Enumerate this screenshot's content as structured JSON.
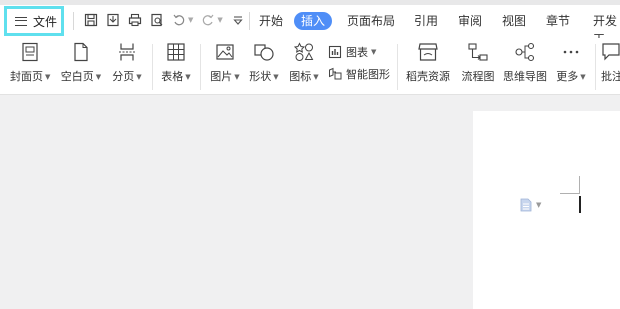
{
  "file_menu": {
    "label": "文件"
  },
  "tabs": [
    {
      "label": "开始"
    },
    {
      "label": "插入"
    },
    {
      "label": "页面布局"
    },
    {
      "label": "引用"
    },
    {
      "label": "审阅"
    },
    {
      "label": "视图"
    },
    {
      "label": "章节"
    },
    {
      "label": "开发工"
    }
  ],
  "active_tab": "插入",
  "ribbon": {
    "cover_page": "封面页",
    "blank_page": "空白页",
    "page_break": "分页",
    "table": "表格",
    "picture": "图片",
    "shape": "形状",
    "icon": "图标",
    "chart": "图表",
    "smartart": "智能图形",
    "resources": "稻壳资源",
    "flowchart": "流程图",
    "mindmap": "思维导图",
    "more": "更多",
    "comment": "批注"
  },
  "colors": {
    "accent": "#4f8ef7",
    "highlight_border": "#5fe0ee"
  }
}
